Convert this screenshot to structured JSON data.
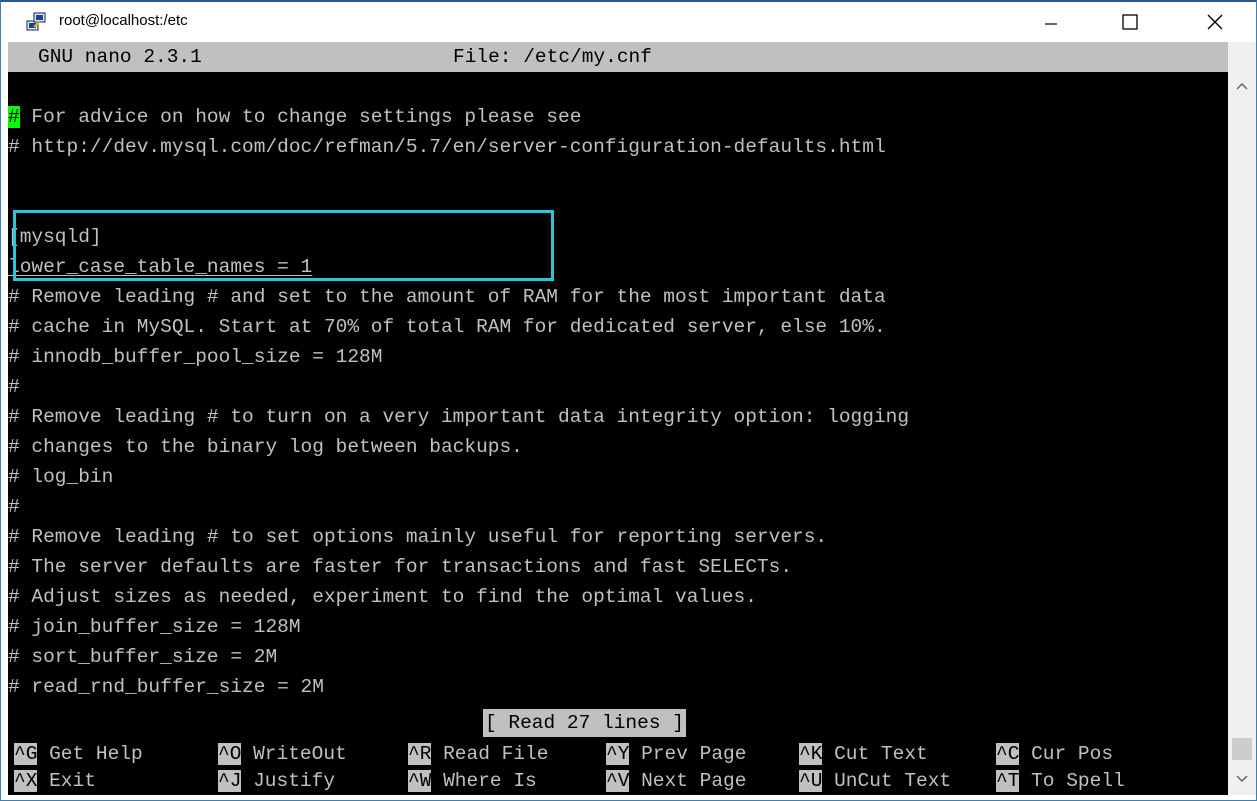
{
  "window": {
    "title": "root@localhost:/etc",
    "minimize_icon": "minimize-icon",
    "maximize_icon": "maximize-icon",
    "close_icon": "close-icon",
    "app_icon": "putty-icon"
  },
  "nano": {
    "version_label": "GNU nano 2.3.1",
    "file_label": "File: /etc/my.cnf",
    "status_message": "[ Read 27 lines ]"
  },
  "lines": [
    {
      "pre": "",
      "text": ""
    },
    {
      "pre": "#",
      "text": " For advice on how to change settings please see"
    },
    {
      "pre": "",
      "text": "# http://dev.mysql.com/doc/refman/5.7/en/server-configuration-defaults.html"
    },
    {
      "pre": "",
      "text": ""
    },
    {
      "pre": "",
      "text": "[mysqld]"
    },
    {
      "pre": "",
      "text": "lower_case_table_names = 1"
    },
    {
      "pre": "",
      "text": "# Remove leading # and set to the amount of RAM for the most important data"
    },
    {
      "pre": "",
      "text": "# cache in MySQL. Start at 70% of total RAM for dedicated server, else 10%."
    },
    {
      "pre": "",
      "text": "# innodb_buffer_pool_size = 128M"
    },
    {
      "pre": "",
      "text": "#"
    },
    {
      "pre": "",
      "text": "# Remove leading # to turn on a very important data integrity option: logging"
    },
    {
      "pre": "",
      "text": "# changes to the binary log between backups."
    },
    {
      "pre": "",
      "text": "# log_bin"
    },
    {
      "pre": "",
      "text": "#"
    },
    {
      "pre": "",
      "text": "# Remove leading # to set options mainly useful for reporting servers."
    },
    {
      "pre": "",
      "text": "# The server defaults are faster for transactions and fast SELECTs."
    },
    {
      "pre": "",
      "text": "# Adjust sizes as needed, experiment to find the optimal values."
    },
    {
      "pre": "",
      "text": "# join_buffer_size = 128M"
    },
    {
      "pre": "",
      "text": "# sort_buffer_size = 2M"
    },
    {
      "pre": "",
      "text": "# read_rnd_buffer_size = 2M"
    }
  ],
  "shortcuts_row1": [
    {
      "key": "^G",
      "label": " Get Help"
    },
    {
      "key": "^O",
      "label": " WriteOut"
    },
    {
      "key": "^R",
      "label": " Read File"
    },
    {
      "key": "^Y",
      "label": " Prev Page"
    },
    {
      "key": "^K",
      "label": " Cut Text"
    },
    {
      "key": "^C",
      "label": " Cur Pos"
    }
  ],
  "shortcuts_row2": [
    {
      "key": "^X",
      "label": " Exit"
    },
    {
      "key": "^J",
      "label": " Justify"
    },
    {
      "key": "^W",
      "label": " Where Is"
    },
    {
      "key": "^V",
      "label": " Next Page"
    },
    {
      "key": "^U",
      "label": " UnCut Text"
    },
    {
      "key": "^T",
      "label": " To Spell"
    }
  ],
  "colors": {
    "terminal_bg": "#000000",
    "terminal_fg": "#c0c0c0",
    "cursor": "#00ff00",
    "highlight_box": "#29c7d9",
    "header_bg": "#c0c0c0"
  }
}
